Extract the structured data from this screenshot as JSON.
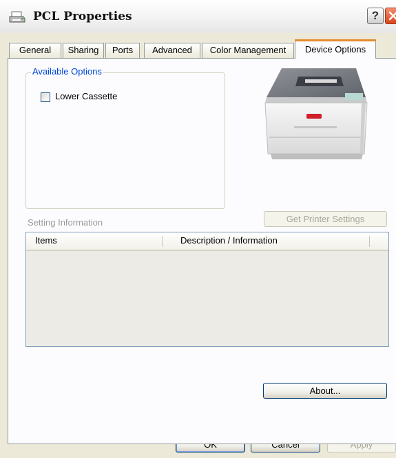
{
  "window": {
    "title": "PCL  Properties",
    "help_label": "?"
  },
  "tabs": [
    {
      "label": "General"
    },
    {
      "label": "Sharing"
    },
    {
      "label": "Ports"
    },
    {
      "label": "Advanced"
    },
    {
      "label": "Color Management"
    },
    {
      "label": "Device Options",
      "active": true
    }
  ],
  "available_options": {
    "legend": "Available Options",
    "items": [
      {
        "label": "Lower Cassette",
        "checked": false
      }
    ]
  },
  "setting_information": {
    "label": "Setting Information",
    "get_settings_label": "Get Printer Settings"
  },
  "list": {
    "columns": [
      "Items",
      "Description / Information"
    ],
    "rows": []
  },
  "buttons": {
    "about": "About...",
    "ok": "OK",
    "cancel": "Cancel",
    "apply": "Apply"
  }
}
